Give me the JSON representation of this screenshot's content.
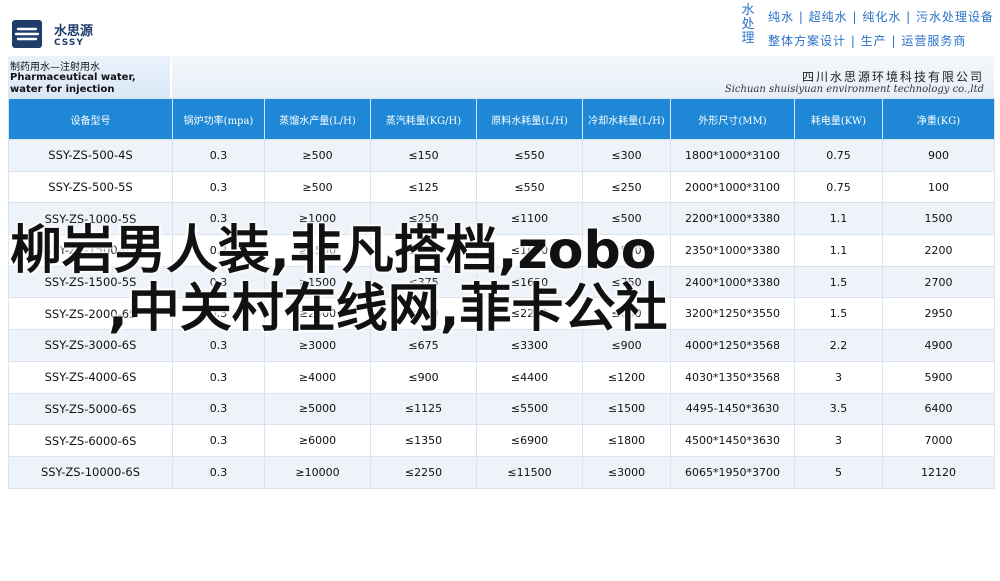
{
  "logo": {
    "name_cn": "水思源",
    "name_en": "CSSY"
  },
  "brand": {
    "vertical": "水处理",
    "line1": "纯水 | 超纯水 | 纯化水 | 污水处理设备",
    "line2": "整体方案设计 | 生产 | 运营服务商"
  },
  "title": {
    "cn": "制药用水—注射用水",
    "en": "Pharmaceutical water, water for injection"
  },
  "company": {
    "cn": "四川水思源环境科技有限公司",
    "en": "Sichuan shuisiyuan environment technology co.,ltd"
  },
  "table": {
    "headers": [
      "设备型号",
      "锅炉功率(mpa)",
      "蒸馏水产量(L/H)",
      "蒸汽耗量(KG/H)",
      "原料水耗量(L/H)",
      "冷却水耗量(L/H)",
      "外形尺寸(MM)",
      "耗电量(KW)",
      "净重(KG)"
    ],
    "rows": [
      [
        "SSY-ZS-500-4S",
        "0.3",
        "≥500",
        "≤150",
        "≤550",
        "≤300",
        "1800*1000*3100",
        "0.75",
        "900"
      ],
      [
        "SSY-ZS-500-5S",
        "0.3",
        "≥500",
        "≤125",
        "≤550",
        "≤250",
        "2000*1000*3100",
        "0.75",
        "100"
      ],
      [
        "SSY-ZS-1000-5S",
        "0.3",
        "≥1000",
        "≤250",
        "≤1100",
        "≤500",
        "2200*1000*3380",
        "1.1",
        "1500"
      ],
      [
        "SSY-ZS-1500-6S",
        "0.3",
        "≥1500",
        "≤300",
        "≤1650",
        "≤500",
        "2350*1000*3380",
        "1.1",
        "2200"
      ],
      [
        "SSY-ZS-1500-5S",
        "0.3",
        "≥1500",
        "≤375",
        "≤1650",
        "≤750",
        "2400*1000*3380",
        "1.5",
        "2700"
      ],
      [
        "SSY-ZS-2000-6S",
        "0.3",
        "≥2000",
        "≤400",
        "≤2200",
        "≤650",
        "3200*1250*3550",
        "1.5",
        "2950"
      ],
      [
        "SSY-ZS-3000-6S",
        "0.3",
        "≥3000",
        "≤675",
        "≤3300",
        "≤900",
        "4000*1250*3568",
        "2.2",
        "4900"
      ],
      [
        "SSY-ZS-4000-6S",
        "0.3",
        "≥4000",
        "≤900",
        "≤4400",
        "≤1200",
        "4030*1350*3568",
        "3",
        "5900"
      ],
      [
        "SSY-ZS-5000-6S",
        "0.3",
        "≥5000",
        "≤1125",
        "≤5500",
        "≤1500",
        "4495-1450*3630",
        "3.5",
        "6400"
      ],
      [
        "SSY-ZS-6000-6S",
        "0.3",
        "≥6000",
        "≤1350",
        "≤6900",
        "≤1800",
        "4500*1450*3630",
        "3",
        "7000"
      ],
      [
        "SSY-ZS-10000-6S",
        "0.3",
        "≥10000",
        "≤2250",
        "≤11500",
        "≤3000",
        "6065*1950*3700",
        "5",
        "12120"
      ]
    ]
  },
  "overlay": {
    "line1": "柳岩男人装,非凡搭档,zobo",
    "line2": ",中关村在线网,菲卡公社"
  },
  "colors": {
    "header_blue": "#1e88d6",
    "brand_blue": "#2a72c7",
    "row_stripe": "#eef3f9"
  }
}
